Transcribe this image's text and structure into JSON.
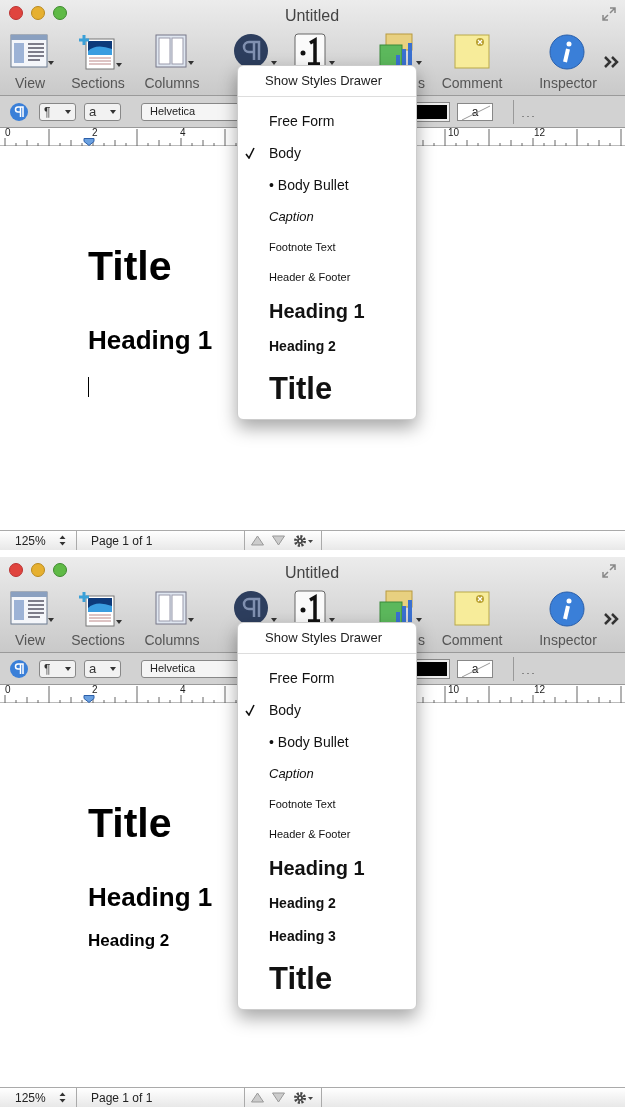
{
  "panels": [
    {
      "window_title": "Untitled",
      "toolbar": [
        {
          "kind": "view",
          "label": "View"
        },
        {
          "kind": "sections",
          "label": "Sections"
        },
        {
          "kind": "columns",
          "label": "Columns"
        },
        {
          "kind": "styles"
        },
        {
          "kind": "lists"
        },
        {
          "kind": "charts",
          "label": "s"
        },
        {
          "kind": "comment",
          "label": "Comment"
        },
        {
          "kind": "inspector",
          "label": "Inspector"
        }
      ],
      "format_bar": {
        "paragraph_popup": "¶",
        "character_popup": "a",
        "font": "Helvetica",
        "color_well_label": "a"
      },
      "ruler": [
        "0",
        "2",
        "4",
        "10",
        "12"
      ],
      "document": {
        "lines": [
          {
            "kind": "title",
            "text": "Title"
          },
          {
            "kind": "heading1",
            "text": "Heading 1"
          }
        ],
        "cursor": true
      },
      "menu": {
        "header": "Show Styles Drawer",
        "items": [
          {
            "kind": "plain",
            "label": "Free Form",
            "checked": false
          },
          {
            "kind": "plain",
            "label": "Body",
            "checked": true
          },
          {
            "kind": "plain",
            "label": "• Body Bullet",
            "checked": false
          },
          {
            "kind": "caption",
            "label": "Caption",
            "checked": false
          },
          {
            "kind": "small",
            "label": "Footnote Text",
            "checked": false
          },
          {
            "kind": "small",
            "label": "Header & Footer",
            "checked": false
          },
          {
            "kind": "heading1",
            "label": "Heading 1",
            "checked": false
          },
          {
            "kind": "heading2",
            "label": "Heading 2",
            "checked": false
          },
          {
            "kind": "title",
            "label": "Title",
            "checked": false
          }
        ]
      },
      "status_bar": {
        "zoom": "125%",
        "page": "Page 1 of 1"
      }
    },
    {
      "window_title": "Untitled",
      "toolbar": [
        {
          "kind": "view",
          "label": "View"
        },
        {
          "kind": "sections",
          "label": "Sections"
        },
        {
          "kind": "columns",
          "label": "Columns"
        },
        {
          "kind": "styles"
        },
        {
          "kind": "lists"
        },
        {
          "kind": "charts",
          "label": "s"
        },
        {
          "kind": "comment",
          "label": "Comment"
        },
        {
          "kind": "inspector",
          "label": "Inspector"
        }
      ],
      "format_bar": {
        "paragraph_popup": "¶",
        "character_popup": "a",
        "font": "Helvetica",
        "color_well_label": "a"
      },
      "ruler": [
        "0",
        "2",
        "4",
        "10",
        "12"
      ],
      "document": {
        "lines": [
          {
            "kind": "title",
            "text": "Title"
          },
          {
            "kind": "heading1",
            "text": "Heading 1"
          },
          {
            "kind": "heading2",
            "text": "Heading 2"
          }
        ],
        "cursor": false
      },
      "menu": {
        "header": "Show Styles Drawer",
        "items": [
          {
            "kind": "plain",
            "label": "Free Form",
            "checked": false
          },
          {
            "kind": "plain",
            "label": "Body",
            "checked": true
          },
          {
            "kind": "plain",
            "label": "• Body Bullet",
            "checked": false
          },
          {
            "kind": "caption",
            "label": "Caption",
            "checked": false
          },
          {
            "kind": "small",
            "label": "Footnote Text",
            "checked": false
          },
          {
            "kind": "small",
            "label": "Header & Footer",
            "checked": false
          },
          {
            "kind": "heading1",
            "label": "Heading 1",
            "checked": false
          },
          {
            "kind": "heading2",
            "label": "Heading 2",
            "checked": false
          },
          {
            "kind": "heading2",
            "label": "Heading 3",
            "checked": false
          },
          {
            "kind": "title",
            "label": "Title",
            "checked": false
          }
        ]
      },
      "status_bar": {
        "zoom": "125%",
        "page": "Page 1 of 1"
      }
    }
  ]
}
